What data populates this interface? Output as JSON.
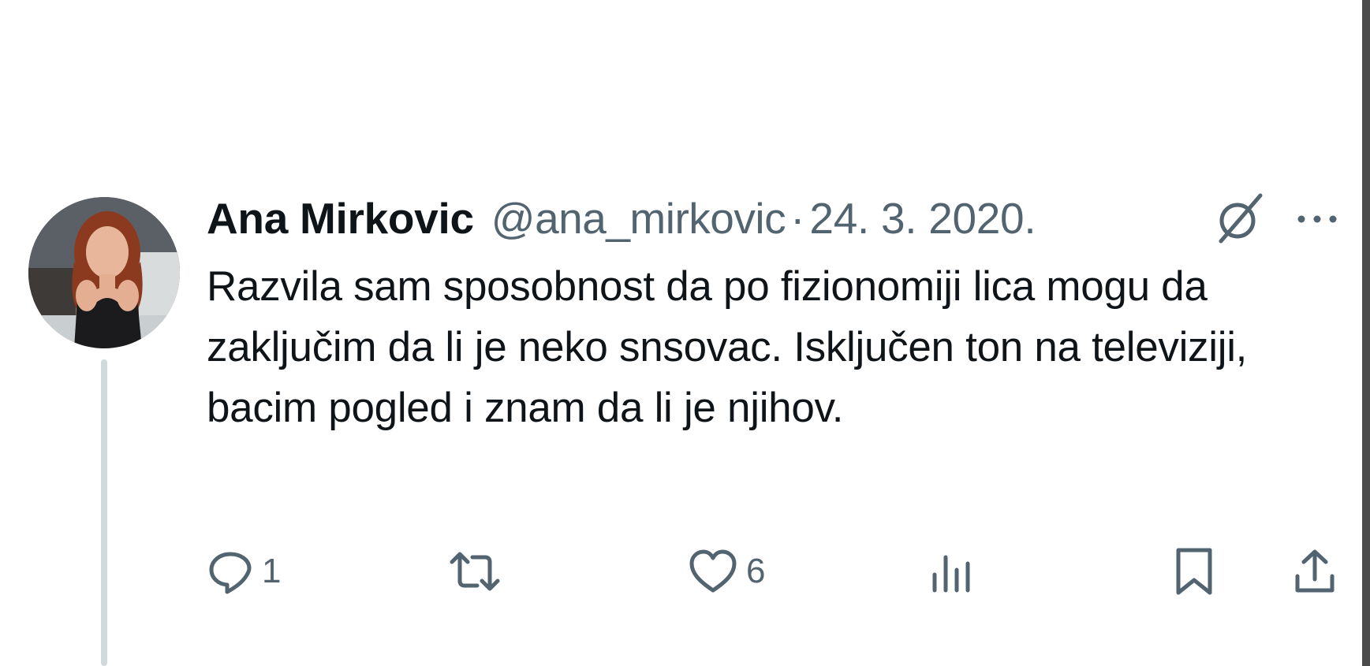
{
  "tweet": {
    "author_name": "Ana Mirkovic",
    "handle": "@ana_mirkovic",
    "separator": "·",
    "date": "24. 3. 2020.",
    "text": "Razvila sam sposobnost da po fizionomiji lica mogu da zaključim da li je neko snsovac. Isključen ton na televiziji, bacim pogled i znam da li je njihov."
  },
  "actions": {
    "reply_count": "1",
    "retweet_count": "",
    "like_count": "6",
    "views_count": ""
  },
  "icons": {
    "avatar": "profile-photo",
    "grok": "grok-icon",
    "more": "more-dots-icon",
    "reply": "reply-icon",
    "retweet": "retweet-icon",
    "like": "heart-icon",
    "views": "analytics-icon",
    "bookmark": "bookmark-icon",
    "share": "share-icon"
  },
  "colors": {
    "text": "#0f1419",
    "secondary": "#536471",
    "thread_line": "#cfd9de"
  }
}
